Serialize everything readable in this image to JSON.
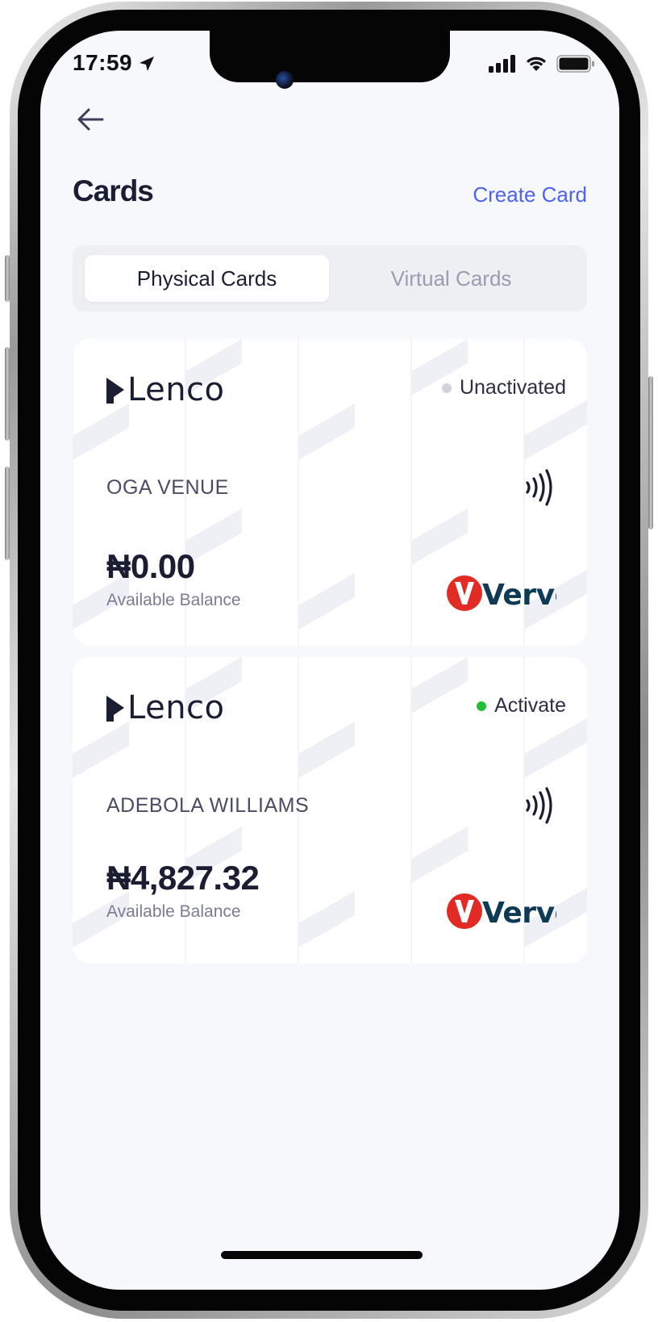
{
  "status_bar": {
    "time": "17:59"
  },
  "header": {
    "title": "Cards",
    "create_card_label": "Create Card"
  },
  "tabs": [
    {
      "label": "Physical Cards",
      "active": true
    },
    {
      "label": "Virtual Cards",
      "active": false
    }
  ],
  "cards": [
    {
      "brand": "Lenco",
      "status": "Unactivated",
      "status_color": "#d0d2dc",
      "holder": "OGA VENUE",
      "balance": "₦0.00",
      "balance_label": "Available Balance",
      "network": "Verve"
    },
    {
      "brand": "Lenco",
      "status": "Activate",
      "status_color": "#22c03a",
      "holder": "ADEBOLA WILLIAMS",
      "balance": "₦4,827.32",
      "balance_label": "Available Balance",
      "network": "Verve"
    }
  ],
  "colors": {
    "accent": "#4e63f0",
    "text_primary": "#1b1d33",
    "verve_red": "#e32b26",
    "verve_navy": "#0f3a55",
    "background": "#f7f8fb"
  }
}
